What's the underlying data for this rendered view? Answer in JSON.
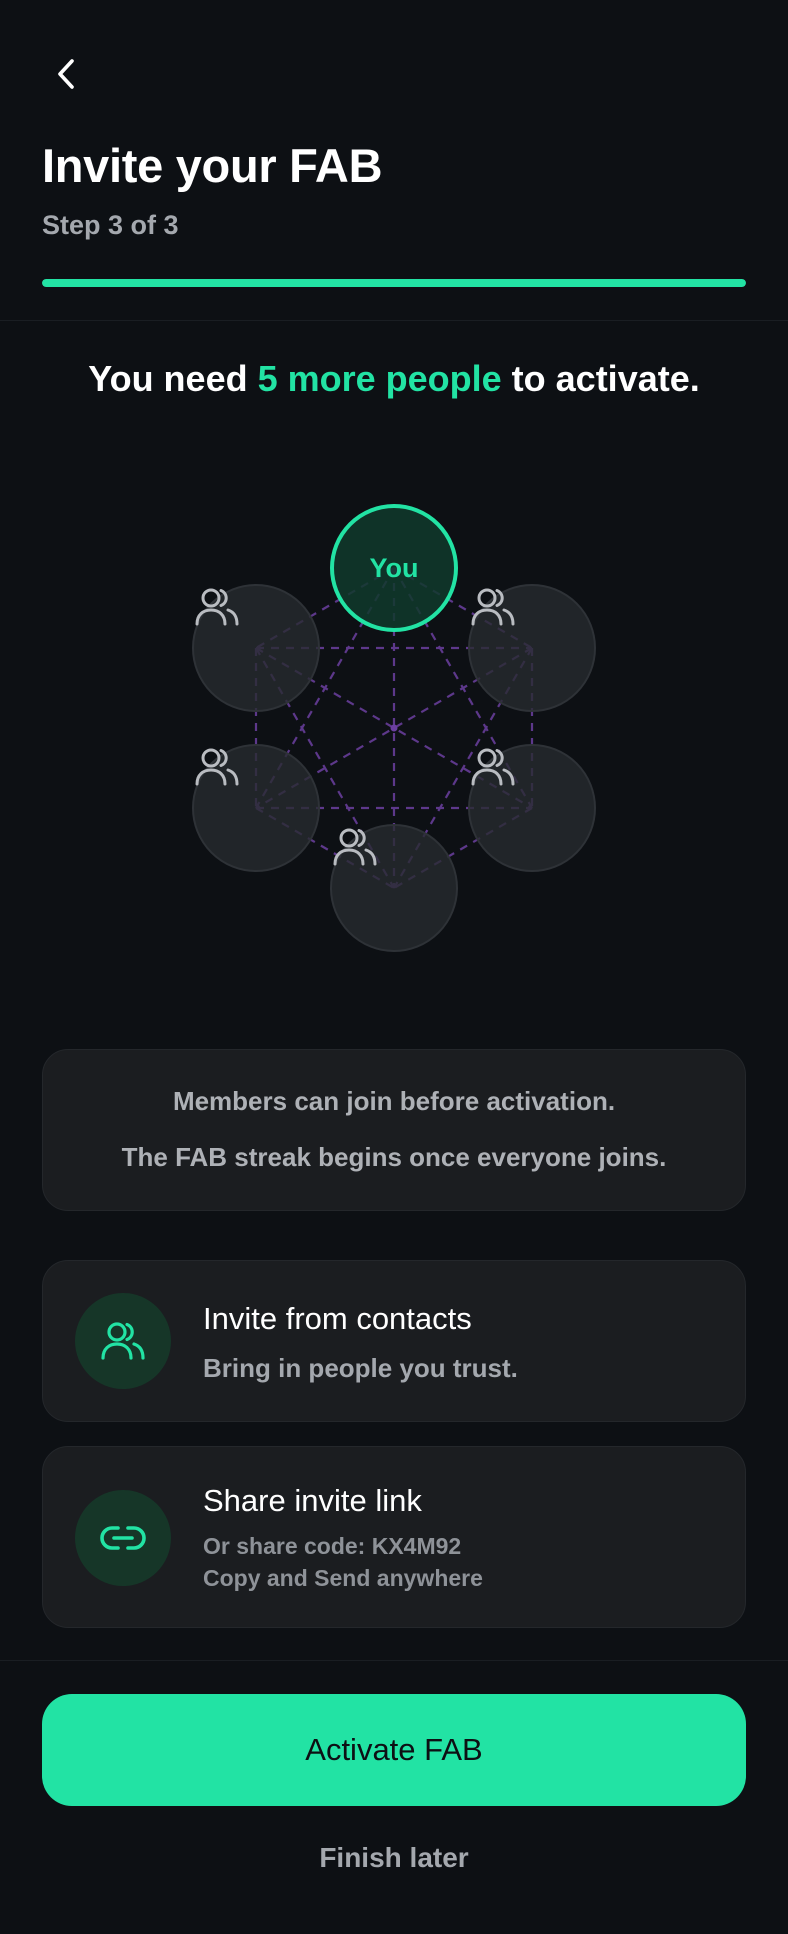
{
  "header": {
    "title": "Invite your FAB",
    "step": "Step 3 of 3",
    "progress": 1.0
  },
  "headline": {
    "prefix": "You need ",
    "highlight": "5 more people",
    "suffix": " to activate."
  },
  "network": {
    "you_label": "You",
    "pending_members": 5
  },
  "info": {
    "line1": "Members can join before activation.",
    "line2": "The FAB streak begins once everyone joins."
  },
  "actions": {
    "contacts": {
      "title": "Invite from contacts",
      "subtitle": "Bring in people you trust.",
      "icon": "users-icon"
    },
    "link": {
      "title": "Share invite link",
      "code_line": "Or share code: KX4M92",
      "copy_line": "Copy and Send anywhere",
      "icon": "link-icon"
    }
  },
  "footer": {
    "primary_label": "Activate FAB",
    "secondary_label": "Finish later"
  },
  "colors": {
    "background": "#0d1014",
    "accent": "#22e3a4",
    "card": "#1b1d20",
    "connector": "#6b3fa0"
  }
}
